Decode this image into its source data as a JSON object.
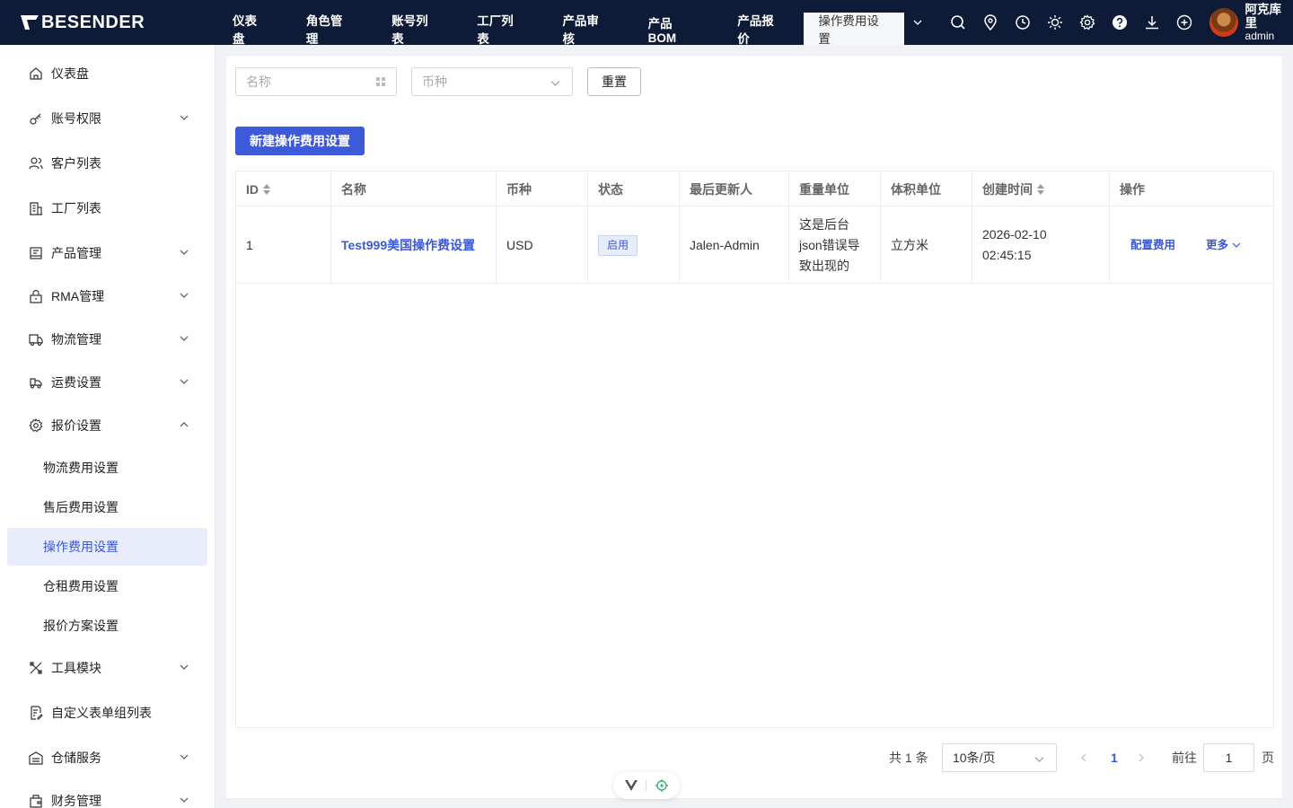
{
  "brand": {
    "name": "BESENDER"
  },
  "nav": {
    "items": [
      "仪表盘",
      "角色管理",
      "账号列表",
      "工厂列表",
      "产品审核",
      "产品BOM",
      "产品报价"
    ],
    "active_tab": "操作费用设置"
  },
  "top_icons": [
    "search-icon",
    "location-icon",
    "clock-icon",
    "sun-icon",
    "gear-icon",
    "help-icon",
    "download-icon",
    "plus-circle-icon"
  ],
  "user": {
    "name": "阿克库里",
    "role": "admin"
  },
  "sidebar": {
    "items": [
      {
        "label": "仪表盘",
        "icon": "home-icon"
      },
      {
        "label": "账号权限",
        "icon": "key-icon"
      },
      {
        "label": "客户列表",
        "icon": "users-icon"
      },
      {
        "label": "工厂列表",
        "icon": "building-icon"
      },
      {
        "label": "产品管理",
        "icon": "box-icon"
      },
      {
        "label": "RMA管理",
        "icon": "lock-icon"
      },
      {
        "label": "物流管理",
        "icon": "truck-icon"
      },
      {
        "label": "运费设置",
        "icon": "freight-icon"
      },
      {
        "label": "报价设置",
        "icon": "gear-icon"
      },
      {
        "label": "工具模块",
        "icon": "tools-icon"
      },
      {
        "label": "自定义表单组列表",
        "icon": "form-icon"
      },
      {
        "label": "仓储服务",
        "icon": "warehouse-icon"
      },
      {
        "label": "财务管理",
        "icon": "finance-icon"
      }
    ],
    "sub_items": [
      "物流费用设置",
      "售后费用设置",
      "操作费用设置",
      "仓租费用设置",
      "报价方案设置"
    ],
    "active_sub": "操作费用设置"
  },
  "filters": {
    "name_placeholder": "名称",
    "currency_placeholder": "币种",
    "reset_label": "重置"
  },
  "actions": {
    "new_label": "新建操作费用设置"
  },
  "table": {
    "columns": [
      "ID",
      "名称",
      "币种",
      "状态",
      "最后更新人",
      "重量单位",
      "体积单位",
      "创建时间",
      "操作"
    ],
    "rows": [
      {
        "id": "1",
        "name": "Test999美国操作费设置",
        "currency": "USD",
        "status": "启用",
        "updated_by": "Jalen-Admin",
        "weight_unit": "这是后台json错误导致出现的",
        "weight_unit_lines": [
          "这是后台",
          "json错误导",
          "致出现的"
        ],
        "volume_unit": "立方米",
        "created_date": "2026-02-10",
        "created_time": "02:45:15",
        "action_config": "配置费用",
        "action_more": "更多"
      }
    ]
  },
  "pagination": {
    "total_text": "共 1 条",
    "page_size": "10条/页",
    "current_page": "1",
    "goto_label": "前往",
    "goto_value": "1",
    "page_suffix": "页"
  },
  "colors": {
    "topbar": "#0d1b36",
    "primary": "#3d5ada",
    "active_bg": "#e9ecfb"
  }
}
